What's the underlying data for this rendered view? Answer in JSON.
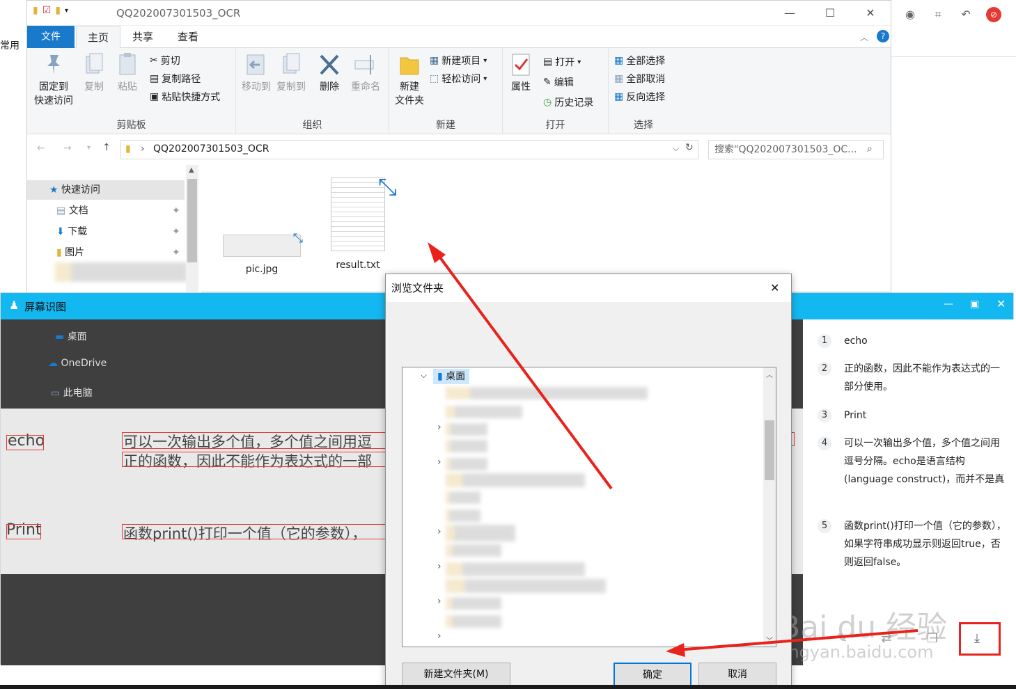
{
  "browser": {
    "left_label": "常用"
  },
  "explorer": {
    "title": "QQ202007301503_OCR",
    "tabs": [
      "文件",
      "主页",
      "共享",
      "查看"
    ],
    "ribbon": {
      "clipboard": {
        "pin_label_1": "固定到",
        "pin_label_2": "快速访问",
        "copy": "复制",
        "paste": "粘贴",
        "cut": "剪切",
        "copy_path": "复制路径",
        "paste_shortcut": "粘贴快捷方式",
        "group": "剪贴板"
      },
      "organize": {
        "move_to": "移动到",
        "copy_to": "复制到",
        "delete": "删除",
        "rename": "重命名",
        "group": "组织"
      },
      "new": {
        "new_folder_1": "新建",
        "new_folder_2": "文件夹",
        "new_item": "新建项目",
        "easy_access": "轻松访问",
        "group": "新建"
      },
      "open": {
        "properties": "属性",
        "open": "打开",
        "edit": "编辑",
        "history": "历史记录",
        "group": "打开"
      },
      "select": {
        "select_all": "全部选择",
        "select_none": "全部取消",
        "invert": "反向选择",
        "group": "选择"
      }
    },
    "address": "QQ202007301503_OCR",
    "search_placeholder": "搜索\"QQ202007301503_OC...",
    "nav": {
      "quick_access": "快速访问",
      "items": [
        "文档",
        "下载",
        "图片"
      ],
      "desktop": "桌面",
      "onedrive": "OneDrive",
      "this_pc": "此电脑"
    },
    "files": [
      "pic.jpg",
      "result.txt"
    ]
  },
  "ocr_window": {
    "title": "屏幕识图",
    "image_text": {
      "echo": "echo",
      "line1": "可以一次输出多个值，多个值之间用逗",
      "line2": "正的函数，因此不能作为表达式的一部",
      "print": "Print",
      "line3": "函数print()打印一个值（它的参数），"
    },
    "results": [
      {
        "num": "1",
        "text": "echo"
      },
      {
        "num": "2",
        "text": "正的函数，因此不能作为表达式的一部分使用。"
      },
      {
        "num": "3",
        "text": "Print"
      },
      {
        "num": "4",
        "text": "可以一次输出多个值，多个值之间用逗号分隔。echo是语言结构(language construct)，而并不是真"
      },
      {
        "num": "5",
        "text": "函数print()打印一个值（它的参数），如果字符串成功显示则返回true，否则返回false。"
      }
    ]
  },
  "dialog": {
    "title": "浏览文件夹",
    "tree_root": "桌面",
    "new_folder": "新建文件夹(M)",
    "ok": "确定",
    "cancel": "取消"
  },
  "watermark": {
    "line1": "Bai du 经验",
    "line2": "jingyan.baidu.com"
  },
  "colors": {
    "accent": "#1979ca",
    "ocr_title_bar": "#13b8f0",
    "annotation_red": "#e8231c"
  }
}
